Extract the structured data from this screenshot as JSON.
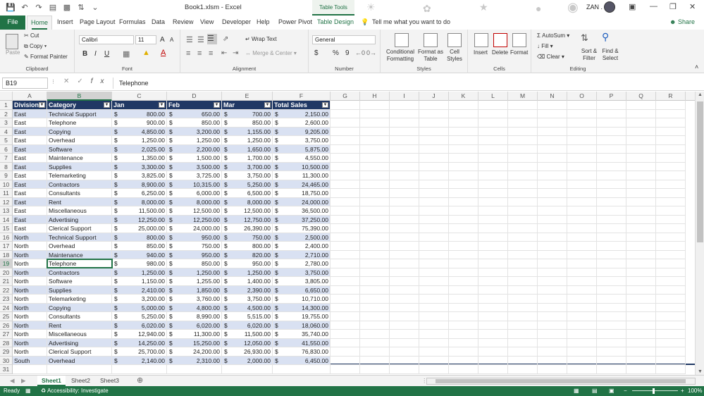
{
  "window": {
    "title": "Book1.xlsm  -  Excel",
    "context_tab": "Table Tools",
    "user": "ZAN .",
    "controls": [
      "—",
      "❐",
      "✕"
    ]
  },
  "tabs": [
    "File",
    "Home",
    "Insert",
    "Page Layout",
    "Formulas",
    "Data",
    "Review",
    "View",
    "Developer",
    "Help",
    "Power Pivot",
    "Table Design"
  ],
  "tell_me": "Tell me what you want to do",
  "share": "Share",
  "ribbon": {
    "clipboard": {
      "label": "Clipboard",
      "paste": "Paste",
      "cut": "Cut",
      "copy": "Copy",
      "format_painter": "Format Painter"
    },
    "font": {
      "label": "Font",
      "name": "Calibri",
      "size": "11",
      "bold": "B",
      "italic": "I",
      "underline": "U",
      "grow": "A",
      "shrink": "A"
    },
    "alignment": {
      "label": "Alignment",
      "wrap": "Wrap Text",
      "merge": "Merge & Center"
    },
    "number": {
      "label": "Number",
      "format": "General",
      "currency": "$",
      "percent": "%",
      "comma": "9"
    },
    "styles": {
      "label": "Styles",
      "conditional": "Conditional Formatting",
      "format_table": "Format as Table",
      "cell_styles": "Cell Styles"
    },
    "cells": {
      "label": "Cells",
      "insert": "Insert",
      "delete": "Delete",
      "format": "Format"
    },
    "editing": {
      "label": "Editing",
      "autosum": "AutoSum",
      "fill": "Fill",
      "clear": "Clear",
      "sort": "Sort & Filter",
      "find": "Find & Select"
    }
  },
  "formula_bar": {
    "name_box": "B19",
    "value": "Telephone"
  },
  "columns": [
    "A",
    "B",
    "C",
    "D",
    "E",
    "F",
    "G",
    "H",
    "I",
    "J",
    "K",
    "L",
    "M",
    "N",
    "O",
    "P",
    "Q",
    "R"
  ],
  "selected_column": "B",
  "selected_row": "19",
  "table": {
    "headers": [
      "Division",
      "Category",
      "Jan",
      "Feb",
      "Mar",
      "Total Sales"
    ],
    "currency_symbol": "$",
    "rows": [
      [
        "East",
        "Technical Support",
        "800.00",
        "650.00",
        "700.00",
        "2,150.00"
      ],
      [
        "East",
        "Telephone",
        "900.00",
        "850.00",
        "850.00",
        "2,600.00"
      ],
      [
        "East",
        "Copying",
        "4,850.00",
        "3,200.00",
        "1,155.00",
        "9,205.00"
      ],
      [
        "East",
        "Overhead",
        "1,250.00",
        "1,250.00",
        "1,250.00",
        "3,750.00"
      ],
      [
        "East",
        "Software",
        "2,025.00",
        "2,200.00",
        "1,650.00",
        "5,875.00"
      ],
      [
        "East",
        "Maintenance",
        "1,350.00",
        "1,500.00",
        "1,700.00",
        "4,550.00"
      ],
      [
        "East",
        "Supplies",
        "3,300.00",
        "3,500.00",
        "3,700.00",
        "10,500.00"
      ],
      [
        "East",
        "Telemarketing",
        "3,825.00",
        "3,725.00",
        "3,750.00",
        "11,300.00"
      ],
      [
        "East",
        "Contractors",
        "8,900.00",
        "10,315.00",
        "5,250.00",
        "24,465.00"
      ],
      [
        "East",
        "Consultants",
        "6,250.00",
        "6,000.00",
        "6,500.00",
        "18,750.00"
      ],
      [
        "East",
        "Rent",
        "8,000.00",
        "8,000.00",
        "8,000.00",
        "24,000.00"
      ],
      [
        "East",
        "Miscellaneous",
        "11,500.00",
        "12,500.00",
        "12,500.00",
        "36,500.00"
      ],
      [
        "East",
        "Advertising",
        "12,250.00",
        "12,250.00",
        "12,750.00",
        "37,250.00"
      ],
      [
        "East",
        "Clerical Support",
        "25,000.00",
        "24,000.00",
        "26,390.00",
        "75,390.00"
      ],
      [
        "North",
        "Technical Support",
        "800.00",
        "950.00",
        "750.00",
        "2,500.00"
      ],
      [
        "North",
        "Overhead",
        "850.00",
        "750.00",
        "800.00",
        "2,400.00"
      ],
      [
        "North",
        "Maintenance",
        "940.00",
        "950.00",
        "820.00",
        "2,710.00"
      ],
      [
        "North",
        "Telephone",
        "980.00",
        "850.00",
        "950.00",
        "2,780.00"
      ],
      [
        "North",
        "Contractors",
        "1,250.00",
        "1,250.00",
        "1,250.00",
        "3,750.00"
      ],
      [
        "North",
        "Software",
        "1,150.00",
        "1,255.00",
        "1,400.00",
        "3,805.00"
      ],
      [
        "North",
        "Supplies",
        "2,410.00",
        "1,850.00",
        "2,390.00",
        "6,650.00"
      ],
      [
        "North",
        "Telemarketing",
        "3,200.00",
        "3,760.00",
        "3,750.00",
        "10,710.00"
      ],
      [
        "North",
        "Copying",
        "5,000.00",
        "4,800.00",
        "4,500.00",
        "14,300.00"
      ],
      [
        "North",
        "Consultants",
        "5,250.00",
        "8,990.00",
        "5,515.00",
        "19,755.00"
      ],
      [
        "North",
        "Rent",
        "6,020.00",
        "6,020.00",
        "6,020.00",
        "18,060.00"
      ],
      [
        "North",
        "Miscellaneous",
        "12,940.00",
        "11,300.00",
        "11,500.00",
        "35,740.00"
      ],
      [
        "North",
        "Advertising",
        "14,250.00",
        "15,250.00",
        "12,050.00",
        "41,550.00"
      ],
      [
        "North",
        "Clerical Support",
        "25,700.00",
        "24,200.00",
        "26,930.00",
        "76,830.00"
      ],
      [
        "South",
        "Overhead",
        "2,140.00",
        "2,310.00",
        "2,000.00",
        "6,450.00"
      ]
    ]
  },
  "sheets": [
    "Sheet1",
    "Sheet2",
    "Sheet3"
  ],
  "active_sheet": "Sheet1",
  "status": {
    "ready": "Ready",
    "accessibility": "Accessibility: Investigate",
    "zoom": "100%"
  }
}
